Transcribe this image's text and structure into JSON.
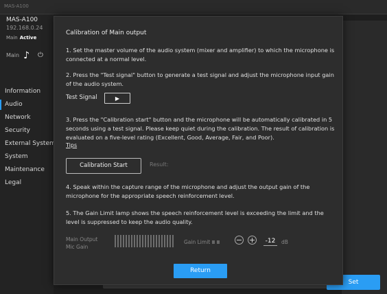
{
  "topbar": {
    "name": "MAS-A100"
  },
  "device": {
    "name": "MAS-A100",
    "ip": "192.168.0.24",
    "status_label": "Main",
    "status_value": "Active",
    "main_label": "Main"
  },
  "nav": {
    "items": [
      {
        "label": "Information"
      },
      {
        "label": "Audio"
      },
      {
        "label": "Network"
      },
      {
        "label": "Security"
      },
      {
        "label": "External System"
      },
      {
        "label": "System"
      },
      {
        "label": "Maintenance"
      },
      {
        "label": "Legal"
      }
    ]
  },
  "dialog": {
    "title": "Calibration of Main output",
    "step1": "1. Set the master volume of the audio system (mixer and amplifier) to which the microphone is connected at a normal level.",
    "step2": "2. Press the \"Test signal\" button to generate a test signal and adjust the microphone input gain of the audio system.",
    "test_signal_label": "Test Signal",
    "step3": "3. Press the \"Calibration start\" button and the microphone will be automatically calibrated in 5 seconds using a test signal. Please keep quiet during the calibration. The result of calibration is evaluated on a five-level rating (Excellent, Good, Average, Fair, and Poor).",
    "tips_label": "Tips",
    "calibration_start_label": "Calibration Start",
    "result_label": "Result:",
    "step4": "4. Speak within the capture range of the microphone and adjust the output gain of the microphone for the appropriate speech reinforcement level.",
    "step5": "5. The Gain Limit lamp shows the speech reinforcement level is exceeding the limit and the level is suppressed to keep the audio quality.",
    "main_output_label": "Main Output",
    "mic_gain_label": "Mic Gain",
    "gain_limit_label": "Gain Limit",
    "gain_value": "-12",
    "gain_unit": "dB",
    "return_label": "Return"
  },
  "footer": {
    "set_label": "Set"
  },
  "colors": {
    "accent": "#2a9df4",
    "background": "#1e1e1e",
    "dialog": "#2d2d2d"
  },
  "icons": {
    "play": "play-icon",
    "minus": "minus-circle-icon",
    "plus": "plus-circle-icon",
    "power": "power-icon",
    "note": "music-note-icon"
  }
}
